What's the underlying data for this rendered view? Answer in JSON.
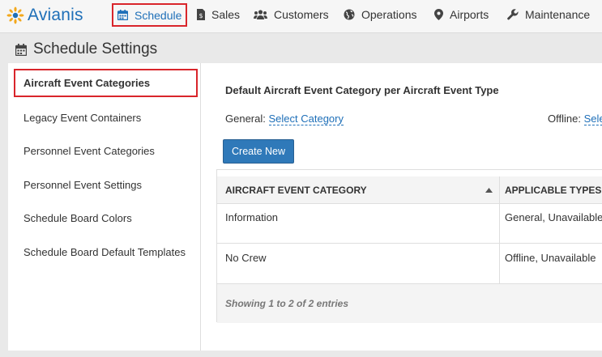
{
  "app": {
    "brand": "Avianis"
  },
  "nav": {
    "schedule": "Schedule",
    "sales": "Sales",
    "customers": "Customers",
    "operations": "Operations",
    "airports": "Airports",
    "maintenance": "Maintenance"
  },
  "page": {
    "title": "Schedule Settings"
  },
  "sidebar": {
    "items": [
      {
        "label": "Aircraft Event Categories"
      },
      {
        "label": "Legacy Event Containers"
      },
      {
        "label": "Personnel Event Categories"
      },
      {
        "label": "Personnel Event Settings"
      },
      {
        "label": "Schedule Board Colors"
      },
      {
        "label": "Schedule Board Default Templates"
      }
    ]
  },
  "content": {
    "section_title": "Default Aircraft Event Category per Aircraft Event Type",
    "general_label": "General:",
    "general_link": "Select Category",
    "offline_label": "Offline:",
    "offline_link": "Select Category",
    "create_button": "Create New"
  },
  "table": {
    "columns": [
      "AIRCRAFT EVENT CATEGORY",
      "APPLICABLE TYPES"
    ],
    "rows": [
      {
        "category": "Information",
        "types": "General, Unavailable"
      },
      {
        "category": "No Crew",
        "types": "Offline, Unavailable"
      }
    ],
    "footer": "Showing 1 to 2 of 2 entries"
  },
  "colors": {
    "accent": "#1e6fb8",
    "highlight": "#d9252b",
    "button": "#2f79b9"
  }
}
